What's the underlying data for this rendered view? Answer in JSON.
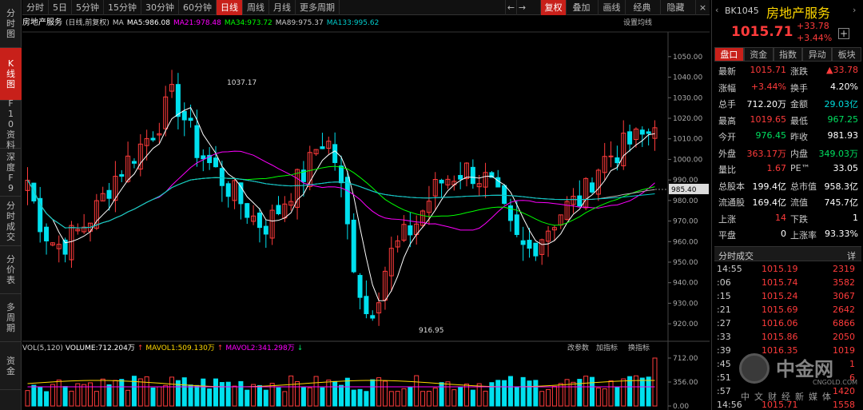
{
  "sidebar": {
    "tabs": [
      "分时图",
      "K线图",
      "F10资料",
      "深度F9",
      "分时成交",
      "分价表",
      "多周期",
      "资金"
    ]
  },
  "toolbar": {
    "periods": [
      "分时",
      "5日",
      "5分钟",
      "15分钟",
      "30分钟",
      "60分钟",
      "日线",
      "周线",
      "月线",
      "更多周期"
    ],
    "active_period": "日线",
    "rights": [
      "复权",
      "叠加",
      "画线",
      "经典",
      "隐藏"
    ],
    "nav": [
      "←",
      "→"
    ],
    "close": "×"
  },
  "chart": {
    "title": "房地产服务",
    "mode": "(日线,前复权)",
    "ma_legend": [
      {
        "text": "MA",
        "color": "#cccccc"
      },
      {
        "text": "MA5:986.08",
        "color": "#ffffff"
      },
      {
        "text": "MA21:978.48",
        "color": "#ff00ff"
      },
      {
        "text": "MA34:973.72",
        "color": "#00ff00"
      },
      {
        "text": "MA89:975.37",
        "color": "#cccccc"
      },
      {
        "text": "MA133:995.62",
        "color": "#00cccc"
      }
    ],
    "settings": "设置均线",
    "high_label": "1037.17",
    "low_label": "916.95",
    "current_price_tag": "985.40",
    "y_ticks": [
      "1050.00",
      "1040.00",
      "1030.00",
      "1020.00",
      "1010.00",
      "1000.00",
      "990.00",
      "980.00",
      "970.00",
      "960.00",
      "950.00",
      "940.00",
      "930.00",
      "920.00"
    ],
    "vol_legend": [
      {
        "text": "VOL(5,120)",
        "color": "#cccccc"
      },
      {
        "text": "VOLUME:712.204万",
        "color": "#ffffff"
      },
      {
        "text": "↑",
        "color": "#ff3b3b"
      },
      {
        "text": "MAVOL1:509.130万",
        "color": "#ffd700"
      },
      {
        "text": "↑",
        "color": "#ff3b3b"
      },
      {
        "text": "MAVOL2:341.298万",
        "color": "#ff00ff"
      },
      {
        "text": "↓",
        "color": "#00e060"
      }
    ],
    "vol_actions": [
      "改参数",
      "加指标",
      "换指标"
    ],
    "vol_ticks": [
      "712.00",
      "356.00",
      "0.00"
    ]
  },
  "chart_data": {
    "type": "candlestick",
    "ylim": [
      915,
      1055
    ],
    "high": 1037.17,
    "low": 916.95,
    "last": 985.4
  },
  "quote": {
    "code": "BK1045",
    "name": "房地产服务",
    "price": "1015.71",
    "change": "+33.78",
    "pct": "+3.44%",
    "tabs": [
      "盘口",
      "资金",
      "指数",
      "异动",
      "板块"
    ],
    "rows": [
      [
        "最新",
        "1015.71",
        "涨跌",
        "▲33.78"
      ],
      [
        "涨幅",
        "+3.44%",
        "换手",
        "4.20%"
      ],
      [
        "总手",
        "712.20万",
        "金额",
        "29.03亿"
      ],
      [
        "最高",
        "1019.65",
        "最低",
        "967.25"
      ],
      [
        "今开",
        "976.45",
        "昨收",
        "981.93"
      ],
      [
        "外盘",
        "363.17万",
        "内盘",
        "349.03万"
      ],
      [
        "量比",
        "1.67",
        "PE™",
        "33.05"
      ],
      [
        "总股本",
        "199.4亿",
        "总市值",
        "958.3亿"
      ],
      [
        "流通股",
        "169.4亿",
        "流值",
        "745.7亿"
      ],
      [
        "上涨",
        "14",
        "下跌",
        "1"
      ],
      [
        "平盘",
        "0",
        "上涨率",
        "93.33%"
      ]
    ]
  },
  "ticks": {
    "title": "分时成交",
    "detail": "详",
    "rows": [
      [
        "14:55",
        "1015.19",
        "2319"
      ],
      [
        ":06",
        "1015.74",
        "3582"
      ],
      [
        ":15",
        "1015.24",
        "3067"
      ],
      [
        ":21",
        "1015.69",
        "2642"
      ],
      [
        ":27",
        "1016.06",
        "6866"
      ],
      [
        ":33",
        "1015.86",
        "2050"
      ],
      [
        ":39",
        "1016.35",
        "1019"
      ],
      [
        ":45",
        "",
        "1"
      ],
      [
        ":51",
        "",
        "6"
      ],
      [
        ":57",
        "",
        "1420"
      ],
      [
        "14:56",
        "1015.71",
        "1558"
      ]
    ]
  },
  "watermark": {
    "brand": "中金网",
    "url": "CNGOLD.COM",
    "slogan": "中文财经新媒体"
  }
}
